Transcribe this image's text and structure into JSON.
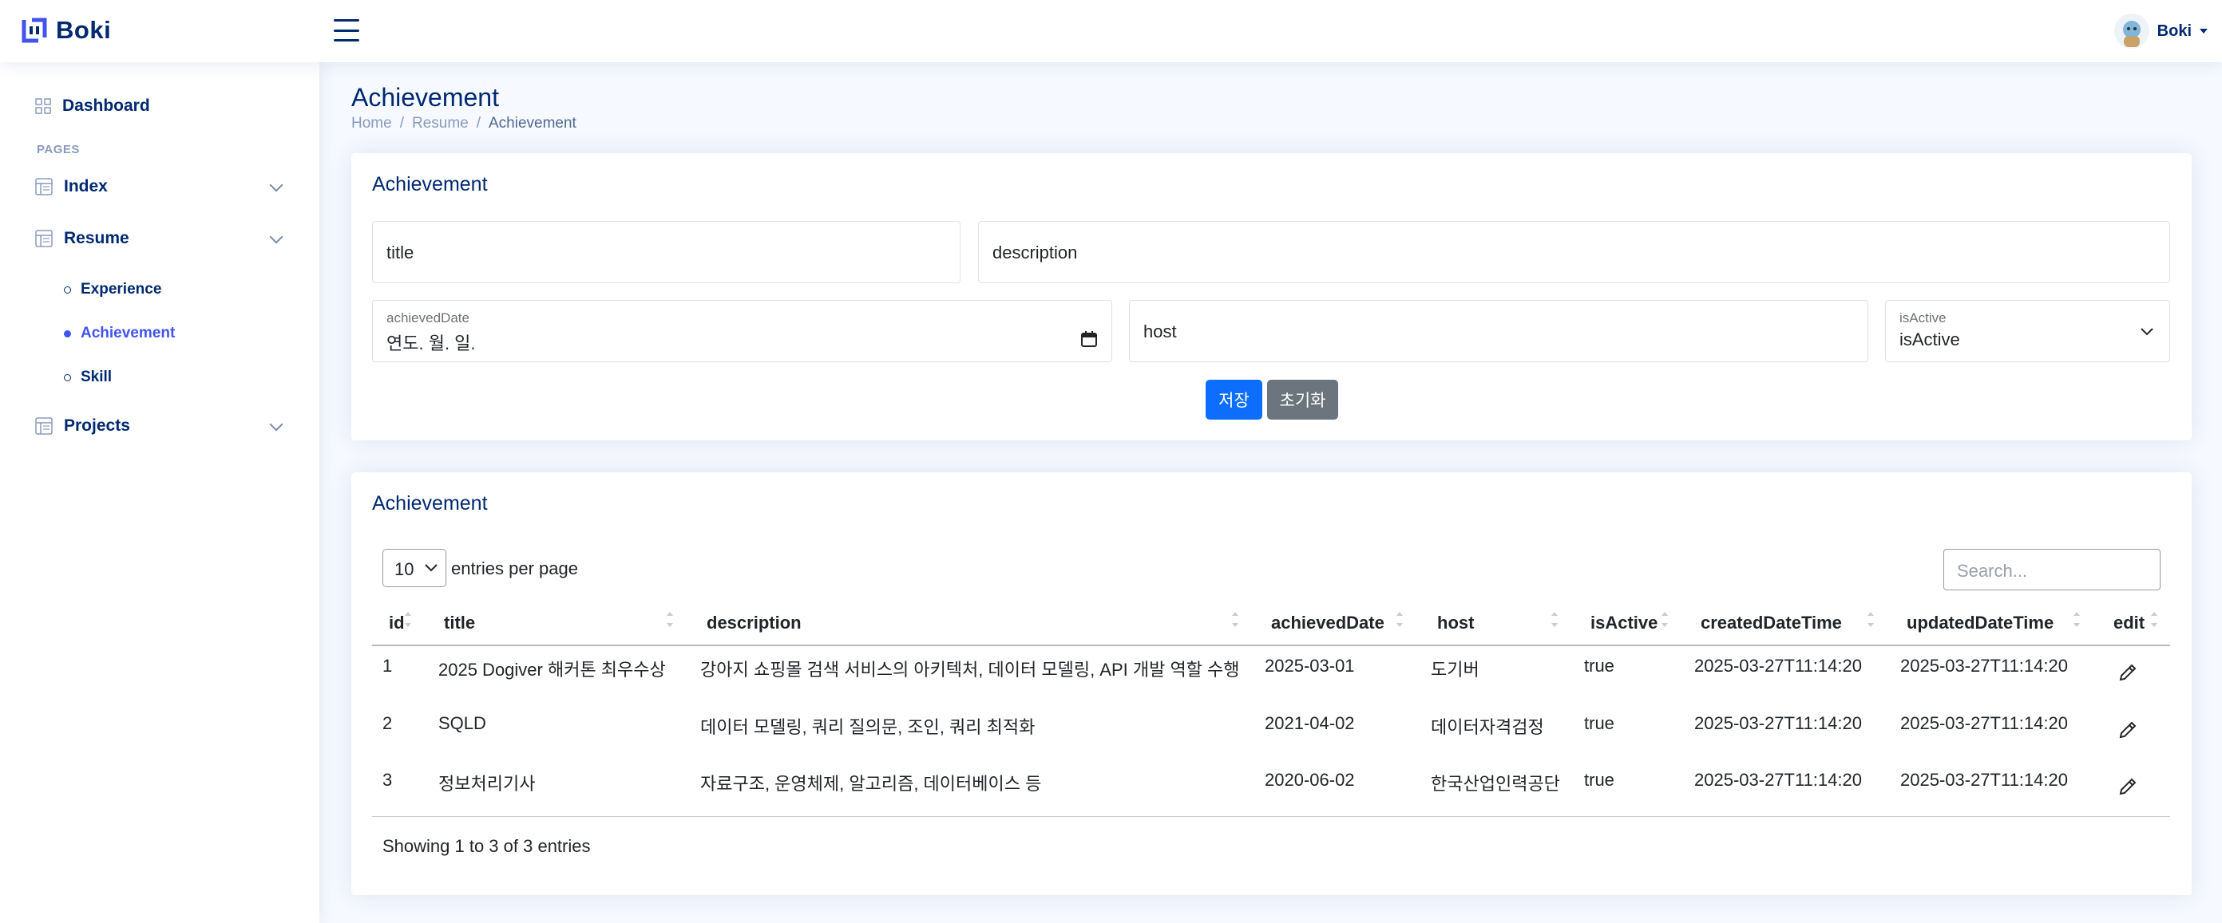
{
  "app": {
    "brand": "Boki"
  },
  "header": {
    "profile_name": "Boki"
  },
  "sidebar": {
    "dashboard": "Dashboard",
    "pages_heading": "Pages",
    "items": [
      {
        "label": "Index",
        "icon": "layout-icon"
      },
      {
        "label": "Resume",
        "icon": "layout-icon"
      },
      {
        "label": "Projects",
        "icon": "layout-icon"
      }
    ],
    "resume_sub": [
      {
        "label": "Experience",
        "active": false
      },
      {
        "label": "Achievement",
        "active": true
      },
      {
        "label": "Skill",
        "active": false
      }
    ]
  },
  "page": {
    "title": "Achievement",
    "breadcrumb": [
      "Home",
      "Resume",
      "Achievement"
    ]
  },
  "form_card": {
    "title": "Achievement",
    "title_placeholder": "title",
    "description_placeholder": "description",
    "achieved_date_label": "achievedDate",
    "achieved_date_value": "연도. 월. 일.",
    "host_placeholder": "host",
    "is_active_label": "isActive",
    "is_active_value": "isActive",
    "save_label": "저장",
    "reset_label": "초기화"
  },
  "table_card": {
    "title": "Achievement",
    "entries_value": "10",
    "entries_label": "entries per page",
    "search_placeholder": "Search...",
    "columns": [
      "id",
      "title",
      "description",
      "achievedDate",
      "host",
      "isActive",
      "createdDateTime",
      "updatedDateTime",
      "edit"
    ],
    "rows": [
      [
        "1",
        "2025 Dogiver 해커톤 최우수상",
        "강아지 쇼핑몰 검색 서비스의 아키텍처, 데이터 모델링, API 개발 역할 수행",
        "2025-03-01",
        "도기버",
        "true",
        "2025-03-27T11:14:20",
        "2025-03-27T11:14:20"
      ],
      [
        "2",
        "SQLD",
        "데이터 모델링, 쿼리 질의문, 조인, 쿼리 최적화",
        "2021-04-02",
        "데이터자격검정",
        "true",
        "2025-03-27T11:14:20",
        "2025-03-27T11:14:20"
      ],
      [
        "3",
        "정보처리기사",
        "자료구조, 운영체제, 알고리즘, 데이터베이스 등",
        "2020-06-02",
        "한국산업인력공단",
        "true",
        "2025-03-27T11:14:20",
        "2025-03-27T11:14:20"
      ]
    ],
    "info": "Showing 1 to 3 of 3 entries"
  },
  "colors": {
    "brand": "#012970",
    "primary": "#0d6efd",
    "secondary": "#6c757d",
    "active_link": "#4154f1"
  }
}
